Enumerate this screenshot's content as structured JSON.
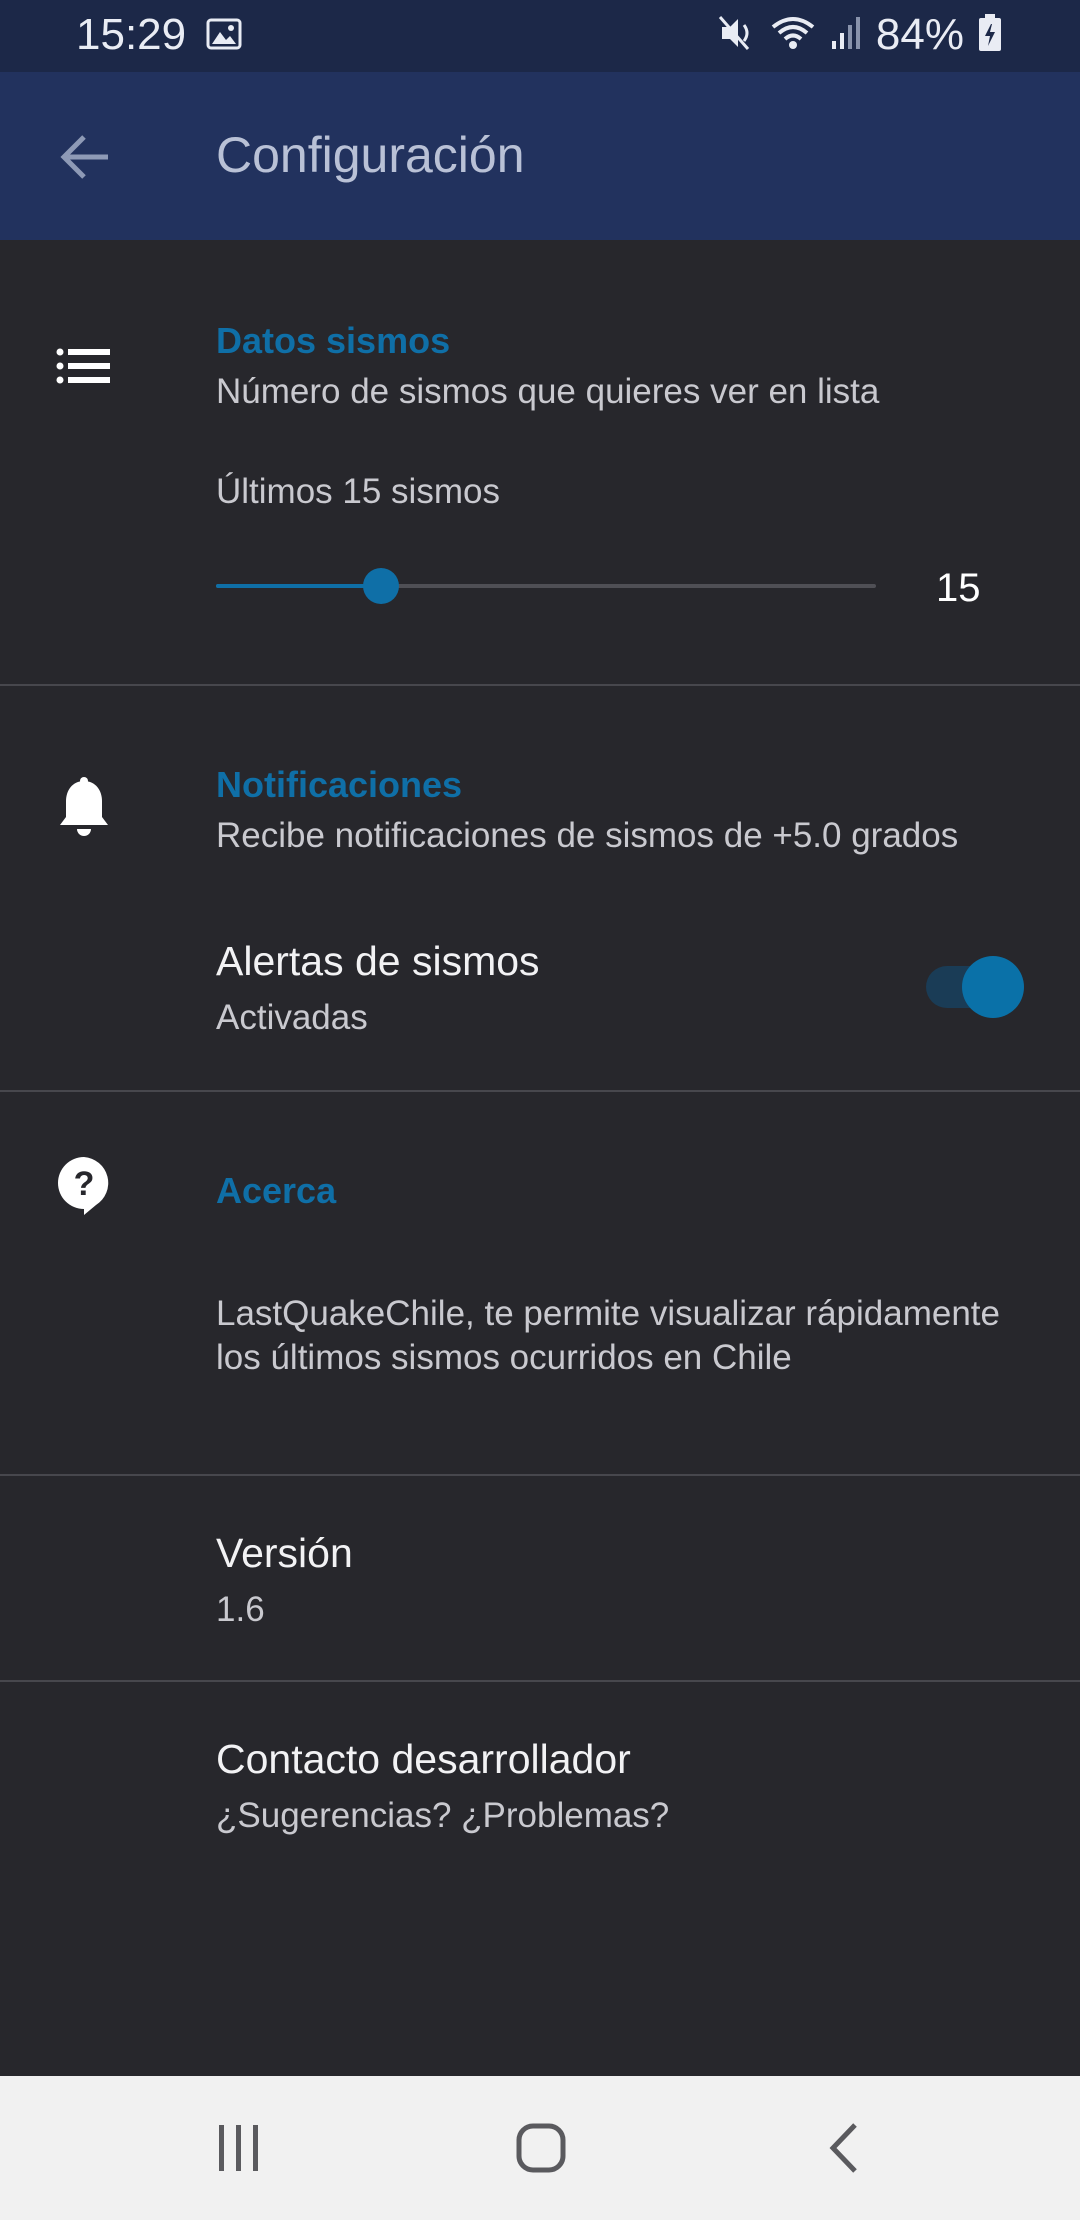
{
  "status_bar": {
    "time": "15:29",
    "battery_pct": "84%",
    "icons": [
      "image-icon",
      "mute-icon",
      "wifi-icon",
      "signal-icon",
      "battery-icon"
    ]
  },
  "app_bar": {
    "title": "Configuración",
    "back_icon": "arrow-back-icon"
  },
  "sections": {
    "data": {
      "icon": "list-icon",
      "title": "Datos sismos",
      "subtitle": "Número de sismos que quieres ver en lista",
      "slider_label": "Últimos 15 sismos",
      "slider_value": "15",
      "slider_fraction": 0.25
    },
    "notifications": {
      "icon": "bell-icon",
      "title": "Notificaciones",
      "subtitle": "Recibe notificaciones de sismos de +5.0 grados",
      "toggle_title": "Alertas de sismos",
      "toggle_status": "Activadas",
      "toggle_on": true
    },
    "about": {
      "icon": "help-icon",
      "title": "Acerca",
      "description": "LastQuakeChile, te permite visualizar rápidamente los últimos sismos ocurridos en Chile"
    },
    "version": {
      "title": "Versión",
      "value": "1.6"
    },
    "contact": {
      "title": "Contacto desarrollador",
      "subtitle": "¿Sugerencias? ¿Problemas?"
    }
  },
  "colors": {
    "accent": "#0f6fa7",
    "background": "#27272c",
    "app_bar": "#22325e",
    "status_bar": "#1c2848"
  },
  "nav_bar": [
    "recents-icon",
    "home-icon",
    "back-icon"
  ]
}
